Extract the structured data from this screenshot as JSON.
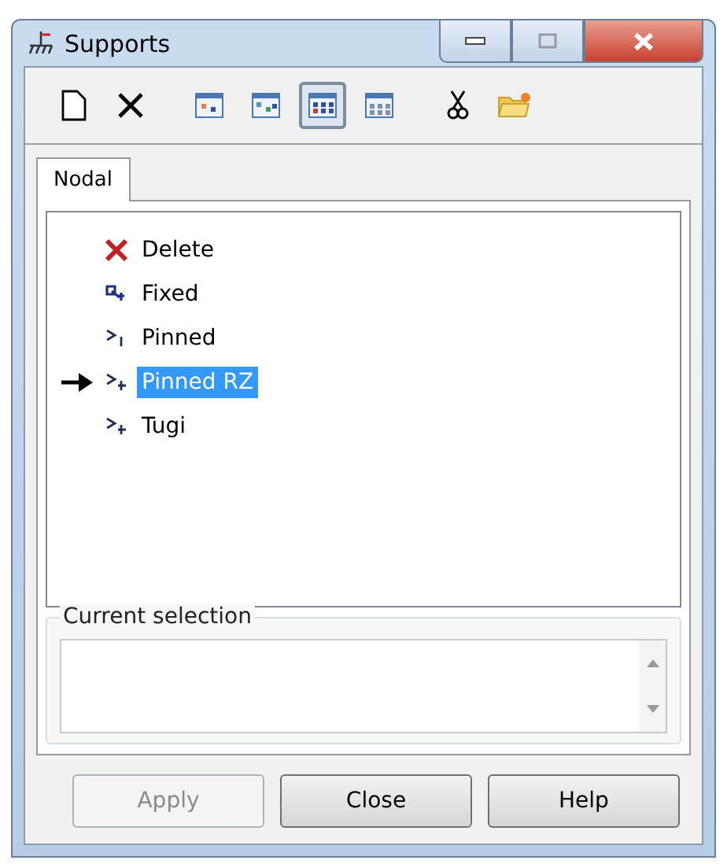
{
  "window": {
    "title": "Supports"
  },
  "toolbar": [
    {
      "kind": "new",
      "pressed": false
    },
    {
      "kind": "delete",
      "pressed": false
    },
    {
      "kind": "view1",
      "pressed": false
    },
    {
      "kind": "view2",
      "pressed": false
    },
    {
      "kind": "view3",
      "pressed": true
    },
    {
      "kind": "view4",
      "pressed": false
    },
    {
      "kind": "cut",
      "pressed": false
    },
    {
      "kind": "open",
      "pressed": false
    }
  ],
  "tabs": [
    {
      "label": "Nodal",
      "selected": true
    }
  ],
  "supports": [
    {
      "kind": "delete",
      "label": "Delete",
      "selected": false,
      "current": false
    },
    {
      "kind": "fixed",
      "label": "Fixed",
      "selected": false,
      "current": false
    },
    {
      "kind": "pinned",
      "label": "Pinned",
      "selected": false,
      "current": false
    },
    {
      "kind": "pinned2",
      "label": "Pinned RZ",
      "selected": true,
      "current": true
    },
    {
      "kind": "pinned2",
      "label": "Tugi",
      "selected": false,
      "current": false
    }
  ],
  "current_selection": {
    "label": "Current selection"
  },
  "buttons": [
    {
      "label": "Apply",
      "disabled": true
    },
    {
      "label": "Close",
      "disabled": false
    },
    {
      "label": "Help",
      "disabled": false
    }
  ]
}
